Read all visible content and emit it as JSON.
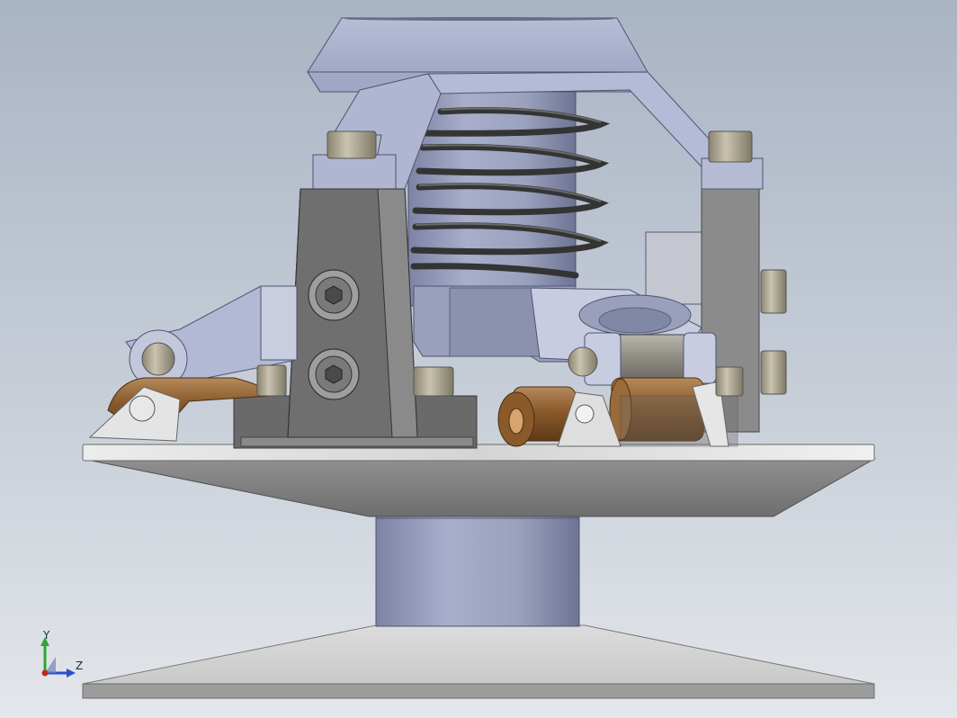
{
  "viewport": {
    "background_top": "#a9b4c4",
    "background_bottom": "#e3e6ea"
  },
  "model": {
    "colors": {
      "steel_light": "#b9bfd6",
      "steel_mid": "#9aa1bd",
      "steel_dark": "#6c7290",
      "bracket_dark": "#6b6b6b",
      "bracket_face": "#858585",
      "spring": "#3a3a3a",
      "bronze": "#8b5a2b",
      "disc_light": "#e6e6e6",
      "disc_edge": "#8f8f8f"
    }
  },
  "triad": {
    "y_label": "Y",
    "z_label": "Z",
    "y_color": "#2fa52f",
    "z_color": "#2a4fd0",
    "origin_color": "#c0262a"
  }
}
